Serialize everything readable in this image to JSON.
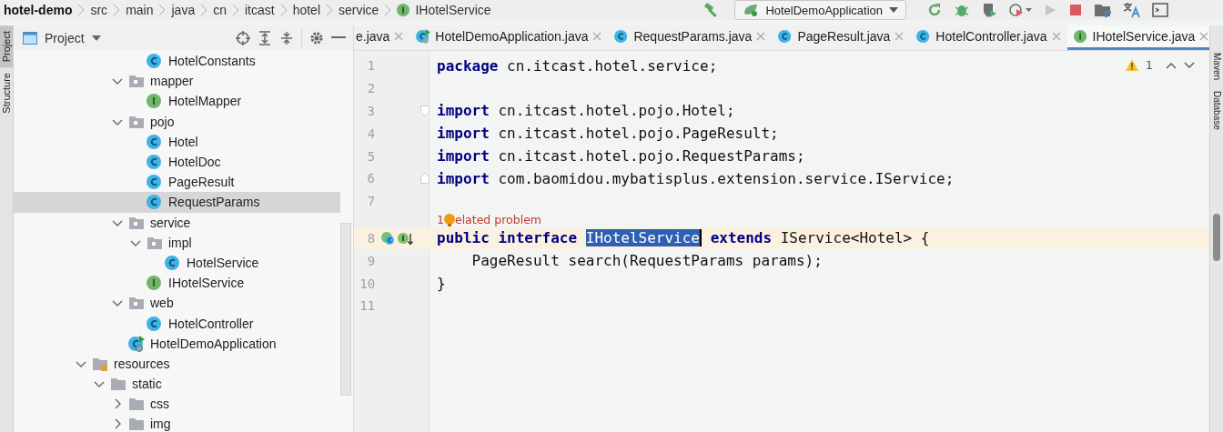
{
  "breadcrumbs": [
    "hotel-demo",
    "src",
    "main",
    "java",
    "cn",
    "itcast",
    "hotel",
    "service",
    "IHotelService"
  ],
  "toolbar": {
    "run_config": "HotelDemoApplication",
    "run_disabled": true
  },
  "side_tabs": [
    {
      "label": "Project",
      "selected": true
    },
    {
      "label": "Structure",
      "selected": false
    }
  ],
  "right_tabs": [
    {
      "label": "Maven"
    },
    {
      "label": "Database"
    }
  ],
  "project_panel": {
    "title": "Project"
  },
  "tree": [
    {
      "children": [
        {
          "children": [
            {
              "children": [
                {
                  "label": "HotelConstants",
                  "kind": "class",
                  "selected": false
                }
              ]
            },
            {
              "label": "mapper",
              "kind": "package",
              "expanded": true,
              "selected": false,
              "children": [
                {
                  "label": "HotelMapper",
                  "kind": "interface",
                  "selected": false
                }
              ]
            },
            {
              "label": "pojo",
              "kind": "package",
              "expanded": true,
              "selected": false,
              "children": [
                {
                  "label": "Hotel",
                  "kind": "class",
                  "selected": false
                },
                {
                  "label": "HotelDoc",
                  "kind": "class",
                  "selected": false
                },
                {
                  "label": "PageResult",
                  "kind": "class",
                  "selected": false
                },
                {
                  "label": "RequestParams",
                  "kind": "class",
                  "selected": true
                }
              ]
            },
            {
              "label": "service",
              "kind": "package",
              "expanded": true,
              "selected": false,
              "children": [
                {
                  "label": "impl",
                  "kind": "package",
                  "expanded": true,
                  "selected": false,
                  "children": [
                    {
                      "label": "HotelService",
                      "kind": "class",
                      "selected": false
                    }
                  ]
                },
                {
                  "label": "IHotelService",
                  "kind": "interface",
                  "selected": false
                }
              ]
            },
            {
              "label": "web",
              "kind": "package",
              "expanded": true,
              "selected": false,
              "children": [
                {
                  "label": "HotelController",
                  "kind": "class",
                  "selected": false
                }
              ]
            },
            {
              "label": "HotelDemoApplication",
              "kind": "app",
              "selected": false
            }
          ]
        }
      ]
    },
    {
      "label": "resources",
      "kind": "resources",
      "expanded": true,
      "selected": false,
      "children": [
        {
          "label": "static",
          "kind": "folder",
          "expanded": true,
          "selected": false,
          "children": [
            {
              "label": "css",
              "kind": "folder",
              "expanded": false,
              "selected": false
            },
            {
              "label": "img",
              "kind": "folder",
              "expanded": false,
              "selected": false
            }
          ]
        }
      ]
    }
  ],
  "tabs": [
    {
      "label": "e.java",
      "kind": "none",
      "selected": false
    },
    {
      "label": "HotelDemoApplication.java",
      "kind": "app",
      "selected": false
    },
    {
      "label": "RequestParams.java",
      "kind": "class",
      "selected": false
    },
    {
      "label": "PageResult.java",
      "kind": "class",
      "selected": false
    },
    {
      "label": "HotelController.java",
      "kind": "class",
      "selected": false
    },
    {
      "label": "IHotelService.java",
      "kind": "interface",
      "selected": true
    }
  ],
  "inspections": {
    "warnings": "1"
  },
  "editor": {
    "lines": [
      {
        "number": "1",
        "current": false,
        "tokens": [
          {
            "kind": "keyword",
            "text": "package"
          },
          {
            "kind": "plain",
            "text": " cn.itcast.hotel.service;"
          }
        ]
      },
      {
        "number": "2",
        "current": false
      },
      {
        "number": "3",
        "current": false,
        "fold_start": true,
        "tokens": [
          {
            "kind": "keyword",
            "text": "import"
          },
          {
            "kind": "plain",
            "text": " cn.itcast.hotel.pojo.Hotel;"
          }
        ]
      },
      {
        "number": "4",
        "current": false,
        "tokens": [
          {
            "kind": "keyword",
            "text": "import"
          },
          {
            "kind": "plain",
            "text": " cn.itcast.hotel.pojo.PageResult;"
          }
        ]
      },
      {
        "number": "5",
        "current": false,
        "tokens": [
          {
            "kind": "keyword",
            "text": "import"
          },
          {
            "kind": "plain",
            "text": " cn.itcast.hotel.pojo.RequestParams;"
          }
        ]
      },
      {
        "number": "6",
        "current": false,
        "fold_end": true,
        "tokens": [
          {
            "kind": "keyword",
            "text": "import"
          },
          {
            "kind": "plain",
            "text": " com.baomidou.mybatisplus.extension.service.IService;"
          }
        ]
      },
      {
        "number": "7",
        "current": false
      },
      {
        "number": "8",
        "current": true,
        "hint": {
          "count": "1",
          "text": "elated problem"
        },
        "markers": true,
        "tokens": [
          {
            "kind": "keyword",
            "text": "public"
          },
          {
            "kind": "keyword",
            "text": " interface "
          },
          {
            "kind": "selected",
            "text": "IHotelService"
          },
          {
            "kind": "keyword",
            "text": " extends"
          },
          {
            "kind": "plain",
            "text": " IService<Hotel> {"
          }
        ]
      },
      {
        "number": "9",
        "current": false,
        "tokens": [
          {
            "kind": "plain",
            "text": "    PageResult search(RequestParams params);"
          }
        ]
      },
      {
        "number": "10",
        "current": false,
        "tokens": [
          {
            "kind": "plain",
            "text": "}"
          }
        ]
      },
      {
        "number": "11",
        "current": false
      }
    ]
  }
}
